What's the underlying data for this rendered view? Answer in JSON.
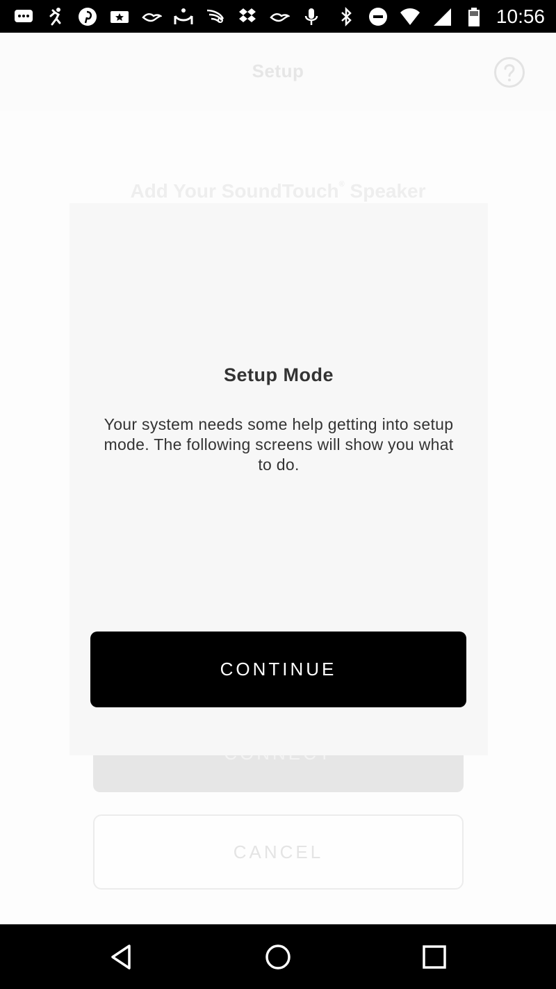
{
  "status_bar": {
    "time": "10:56",
    "left_icons": [
      "messages-icon",
      "run-icon",
      "pinterest-icon",
      "ticket-icon",
      "bird-icon",
      "hammock-icon",
      "feather-icon",
      "dropbox-icon",
      "bird-icon",
      "microphone-icon"
    ],
    "right_icons": [
      "bluetooth-icon",
      "do-not-disturb-icon",
      "wifi-icon",
      "cell-signal-icon",
      "battery-icon"
    ]
  },
  "header": {
    "title": "Setup",
    "help_icon": "help-icon"
  },
  "background": {
    "heading": "Add Your SoundTouch",
    "heading_mark": "®",
    "heading_suffix": " Speaker",
    "connect_label": "CONNECT",
    "cancel_label": "CANCEL"
  },
  "modal": {
    "title": "Setup Mode",
    "body": "Your system needs some help getting into setup mode. The following screens will show you what to do.",
    "continue_label": "CONTINUE"
  },
  "nav_bar": {
    "icons": [
      "back-icon",
      "home-icon",
      "recents-icon"
    ]
  },
  "colors": {
    "primary_button": "#000000",
    "modal_background": "#f7f7f7",
    "text_dark": "#333333"
  }
}
